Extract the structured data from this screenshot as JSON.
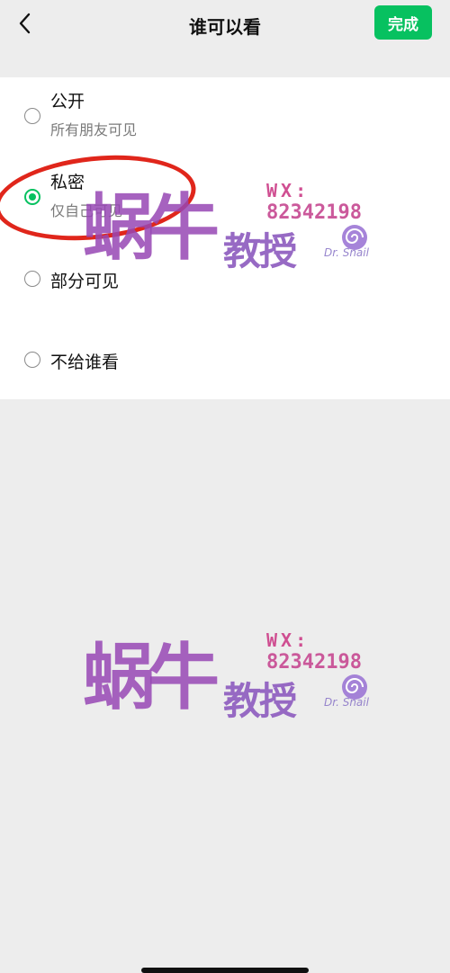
{
  "header": {
    "title": "谁可以看",
    "done_label": "完成"
  },
  "options": [
    {
      "label": "公开",
      "sub": "所有朋友可见",
      "selected": false
    },
    {
      "label": "私密",
      "sub": "仅自己可见",
      "selected": true
    },
    {
      "label": "部分可见",
      "sub": "",
      "selected": false
    },
    {
      "label": "不给谁看",
      "sub": "",
      "selected": false
    }
  ],
  "watermark": {
    "big": "蜗牛",
    "small": "教授",
    "wx": "WX:",
    "number": "82342198",
    "dr": "Dr. Snail"
  },
  "colors": {
    "accent": "#07c160",
    "annotation": "#e0261b",
    "background": "#ededed"
  }
}
